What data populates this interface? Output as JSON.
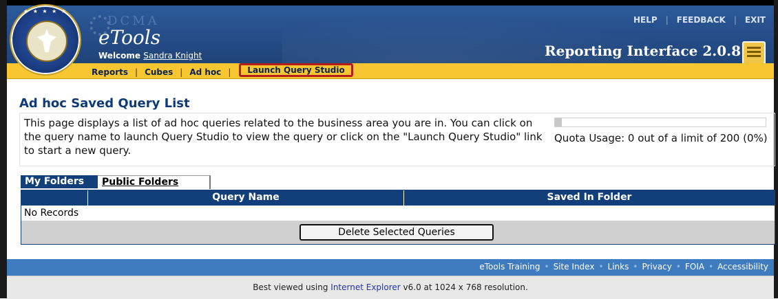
{
  "header": {
    "org_text": "DCMA",
    "app_name": "eTools",
    "welcome_label": "Welcome",
    "user_name": "Sandra Knight",
    "top_links": [
      "HELP",
      "FEEDBACK",
      "EXIT"
    ],
    "app_title": "Reporting Interface 2.0.8"
  },
  "nav": {
    "items": [
      "Reports",
      "Cubes",
      "Ad hoc"
    ],
    "highlighted": "Launch Query Studio"
  },
  "main": {
    "title": "Ad hoc Saved Query List",
    "description": "This page displays a list of ad hoc queries related to the business area you are in. You can click on the query name to launch Query Studio to view the query or click on the \"Launch Query Studio\" link to start a new query.",
    "quota_text": "Quota Usage: 0 out of a limit of 200 (0%)",
    "quota_fraction": 0.0
  },
  "tabs": [
    "My Folders",
    "Public Folders"
  ],
  "table": {
    "columns": [
      "",
      "Query Name",
      "Saved In Folder"
    ],
    "empty_text": "No Records",
    "delete_button": "Delete Selected Queries"
  },
  "footer": {
    "links": [
      "eTools Training",
      "Site Index",
      "Links",
      "Privacy",
      "FOIA",
      "Accessibility"
    ],
    "best_view_prefix": "Best viewed using",
    "best_view_link": "Internet Explorer",
    "best_view_suffix": "v6.0 at 1024 x 768 resolution."
  },
  "colors": {
    "header_blue": "#244c86",
    "nav_yellow": "#f7c631",
    "table_header": "#123f7a",
    "highlight_red": "#b71c1c"
  }
}
